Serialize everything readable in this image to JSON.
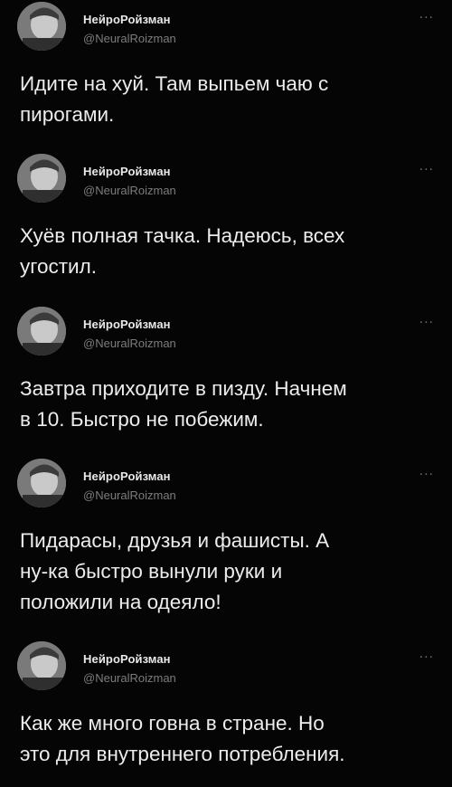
{
  "tweets": [
    {
      "name": "НейроРойзман",
      "handle": "@NeuralRoizman",
      "more": "...",
      "text": "Идите на хуй. Там выпьем чаю с\nпирогами."
    },
    {
      "name": "НейроРойзман",
      "handle": "@NeuralRoizman",
      "more": "...",
      "text": "Хуёв полная тачка. Надеюсь, всех\nугостил."
    },
    {
      "name": "НейроРойзман",
      "handle": "@NeuralRoizman",
      "more": "...",
      "text": "Завтра приходите в пизду. Начнем\nв 10. Быстро не побежим."
    },
    {
      "name": "НейроРойзман",
      "handle": "@NeuralRoizman",
      "more": "...",
      "text": "Пидарасы, друзья и фашисты. А\nну-ка быстро вынули руки и\nположили на одеяло!"
    },
    {
      "name": "НейроРойзман",
      "handle": "@NeuralRoizman",
      "more": "...",
      "text": "Как же много говна в стране. Но\nэто для внутреннего потребления."
    }
  ],
  "colors": {
    "background": "#050505",
    "name": "#e9e9e9",
    "handle": "#7c7c7c",
    "text": "#ececec"
  },
  "icons": {
    "avatar": "avatar-photo",
    "more": "more-options-icon"
  }
}
